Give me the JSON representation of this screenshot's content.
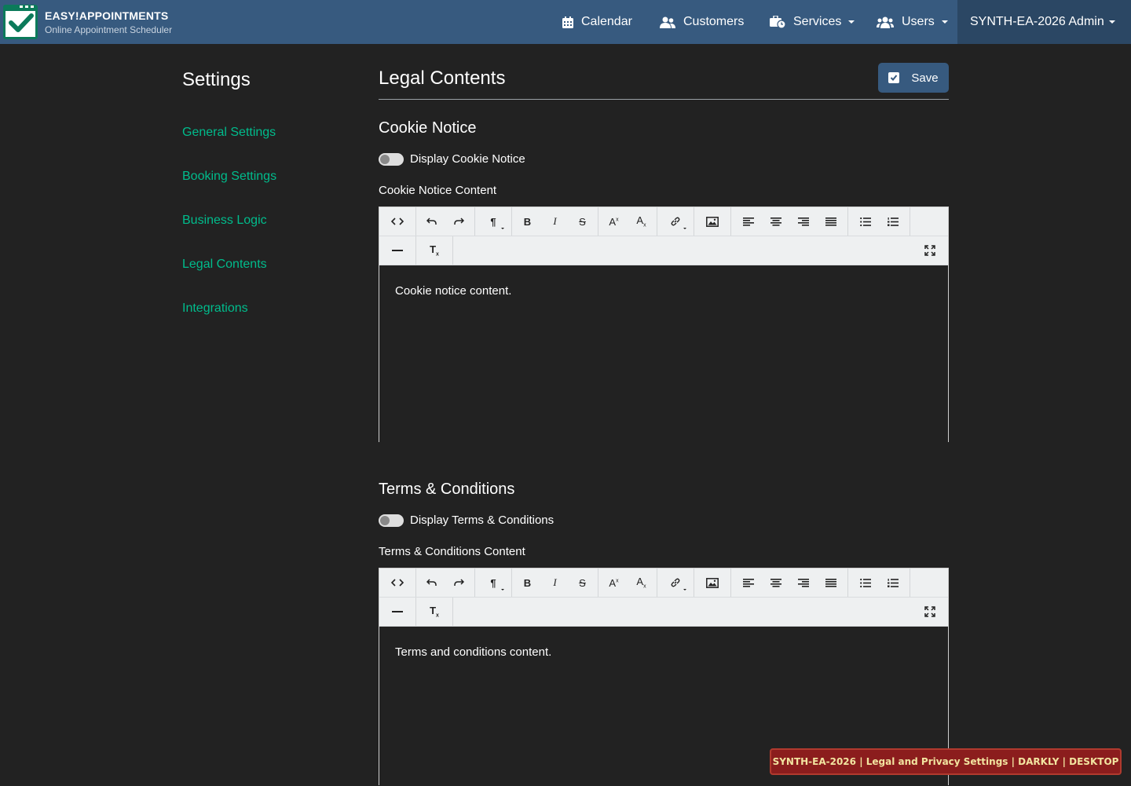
{
  "navbar": {
    "brand_title": "EASY!APPOINTMENTS",
    "brand_subtitle": "Online Appointment Scheduler",
    "items": [
      {
        "label": "Calendar",
        "icon": "calendar-icon"
      },
      {
        "label": "Customers",
        "icon": "users-icon"
      },
      {
        "label": "Services",
        "icon": "briefcase-clock-icon",
        "dropdown": true
      },
      {
        "label": "Users",
        "icon": "users-group-icon",
        "dropdown": true
      }
    ],
    "admin_label": "SYNTH-EA-2026 Admin",
    "bg_color": "#375a7f"
  },
  "sidebar": {
    "title": "Settings",
    "items": [
      {
        "label": "General Settings"
      },
      {
        "label": "Booking Settings"
      },
      {
        "label": "Business Logic"
      },
      {
        "label": "Legal Contents"
      },
      {
        "label": "Integrations"
      }
    ],
    "link_color": "#00bc8c"
  },
  "main": {
    "title": "Legal Contents",
    "save_label": "Save",
    "cookie": {
      "section_title": "Cookie Notice",
      "toggle_label": "Display Cookie Notice",
      "toggle_on": false,
      "content_label": "Cookie Notice Content",
      "content_text": "Cookie notice content."
    },
    "terms": {
      "section_title": "Terms & Conditions",
      "toggle_label": "Display Terms & Conditions",
      "toggle_on": false,
      "content_label": "Terms & Conditions Content",
      "content_text": "Terms and conditions content."
    }
  },
  "badge": {
    "text": "SYNTH-EA-2026 | Legal and Privacy Settings | DARKLY | DESKTOP"
  }
}
